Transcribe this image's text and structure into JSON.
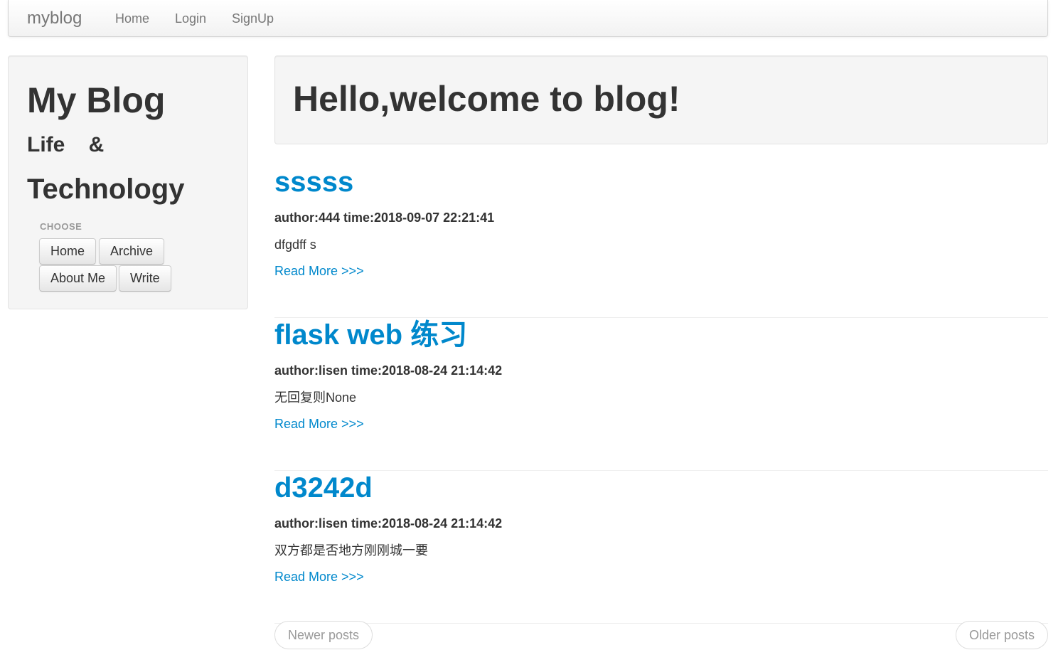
{
  "navbar": {
    "brand": "myblog",
    "links": [
      "Home",
      "Login",
      "SignUp"
    ]
  },
  "sidebar": {
    "title": "My Blog",
    "subtitle_line1": "Life    &",
    "subtitle_line2": "Technology",
    "choose_label": "CHOOSE",
    "buttons": [
      "Home",
      "Archive",
      "About Me",
      "Write"
    ]
  },
  "hero": {
    "title": "Hello,welcome to blog!"
  },
  "posts": [
    {
      "title": "sssss",
      "meta": "author:444 time:2018-09-07 22:21:41",
      "body": "dfgdff s",
      "read_more": "Read More >>>"
    },
    {
      "title": "flask web 练习",
      "meta": "author:lisen time:2018-08-24 21:14:42",
      "body": "无回复则None",
      "read_more": "Read More >>>"
    },
    {
      "title": "d3242d",
      "meta": "author:lisen time:2018-08-24 21:14:42",
      "body": "双方都是否地方刚刚城一要",
      "read_more": "Read More >>>"
    }
  ],
  "pager": {
    "newer": "Newer posts",
    "older": "Older posts"
  },
  "colors": {
    "link": "#0088cc",
    "text": "#333333",
    "muted": "#777777",
    "well_bg": "#f5f5f5"
  }
}
